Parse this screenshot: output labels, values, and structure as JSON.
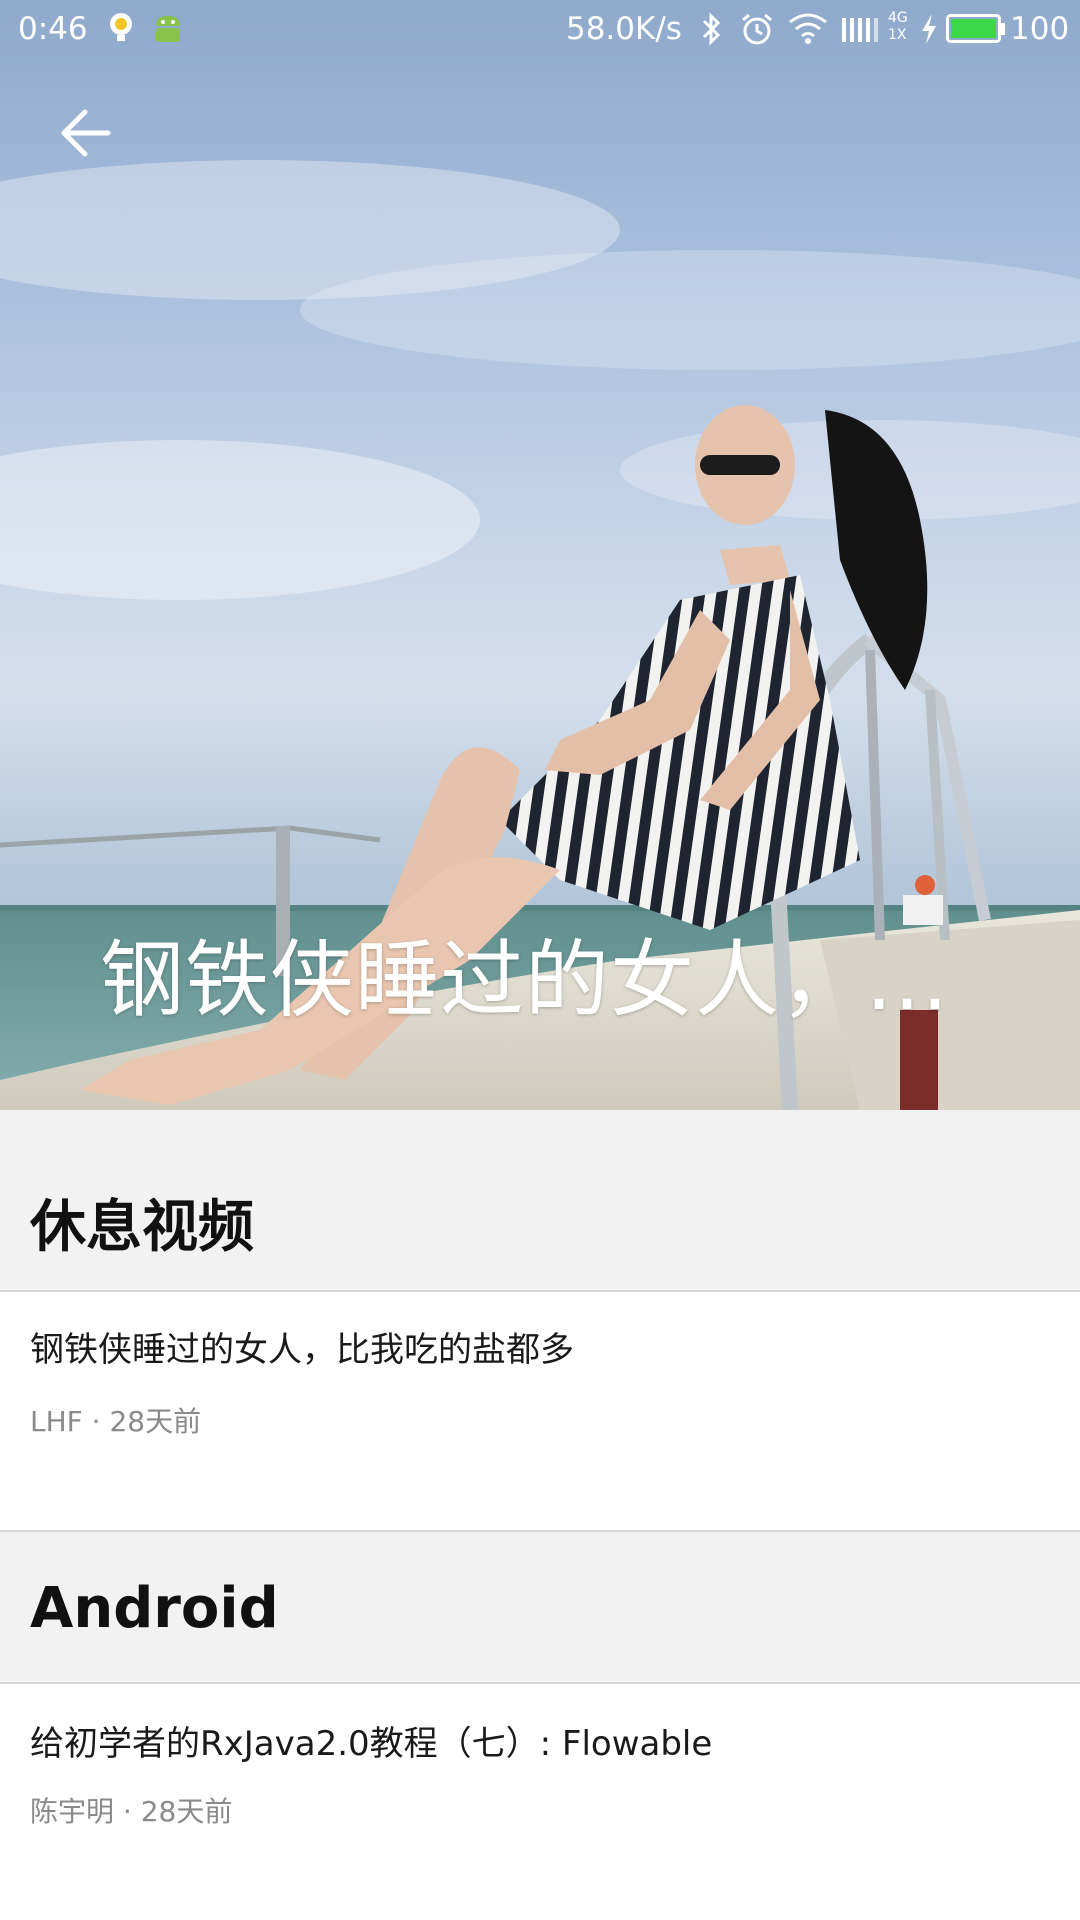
{
  "status_bar": {
    "time": "0:46",
    "network_speed": "58.0K/s",
    "network_type_top": "4G",
    "network_type_bottom": "1X",
    "battery_level": "100",
    "icons": [
      "lightbulb-icon",
      "android-icon",
      "bluetooth-icon",
      "alarm-icon",
      "wifi-icon",
      "signal-icon",
      "charging-icon",
      "battery-icon"
    ],
    "battery_color": "#3cd84a"
  },
  "toolbar": {
    "back_icon": "arrow-left-icon",
    "title": "钢铁侠睡过的女人，比我吃的盐都多"
  },
  "sections": [
    {
      "title": "休息视频",
      "items": [
        {
          "title": "钢铁侠睡过的女人，比我吃的盐都多",
          "meta": "LHF · 28天前"
        }
      ]
    },
    {
      "title": "Android",
      "items": [
        {
          "title": "给初学者的RxJava2.0教程（七）: Flowable",
          "meta": "陈宇明 · 28天前"
        }
      ]
    }
  ],
  "colors": {
    "section_background": "#f2f2f2",
    "divider": "#d7d7d7",
    "meta_text": "#8a8a8a"
  }
}
